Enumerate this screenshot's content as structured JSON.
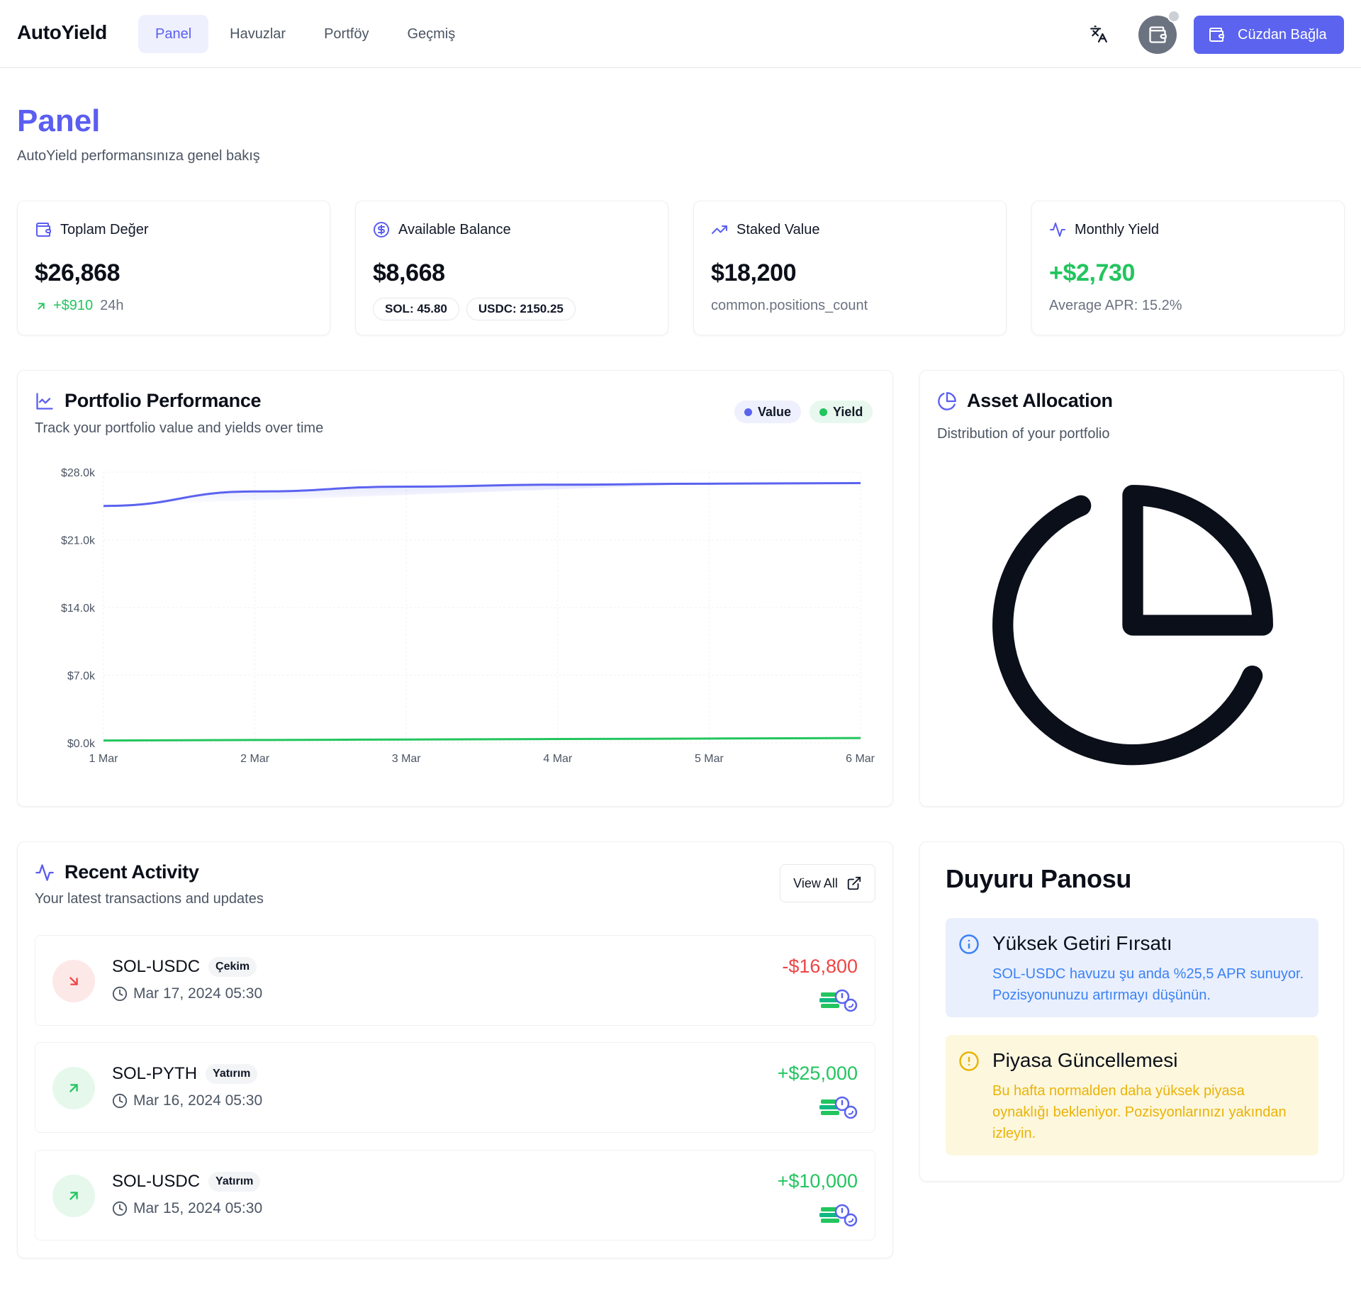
{
  "header": {
    "brand": "AutoYield",
    "nav": [
      {
        "label": "Panel",
        "active": true
      },
      {
        "label": "Havuzlar",
        "active": false
      },
      {
        "label": "Portföy",
        "active": false
      },
      {
        "label": "Geçmiş",
        "active": false
      }
    ],
    "connect_label": "Cüzdan Bağla"
  },
  "page": {
    "title": "Panel",
    "subtitle": "AutoYield performansınıza genel bakış"
  },
  "stats": {
    "total": {
      "label": "Toplam Değer",
      "value": "$26,868",
      "change": "+$910",
      "period": "24h"
    },
    "available": {
      "label": "Available Balance",
      "value": "$8,668",
      "sol": "SOL: 45.80",
      "usdc": "USDC: 2150.25"
    },
    "staked": {
      "label": "Staked Value",
      "value": "$18,200",
      "foot": "common.positions_count"
    },
    "monthly": {
      "label": "Monthly Yield",
      "value": "+$2,730",
      "foot": "Average APR: 15.2%"
    }
  },
  "performance": {
    "title": "Portfolio Performance",
    "subtitle": "Track your portfolio value and yields over time",
    "legend_value": "Value",
    "legend_yield": "Yield"
  },
  "chart_data": {
    "type": "area",
    "categories": [
      "1 Mar",
      "2 Mar",
      "3 Mar",
      "4 Mar",
      "5 Mar",
      "6 Mar"
    ],
    "series": [
      {
        "name": "Value",
        "values": [
          24500,
          26000,
          26500,
          26700,
          26800,
          26868
        ]
      },
      {
        "name": "Yield",
        "values": [
          250,
          300,
          350,
          400,
          450,
          500
        ]
      }
    ],
    "y_ticks": [
      "$0.0k",
      "$7.0k",
      "$14.0k",
      "$21.0k",
      "$28.0k"
    ],
    "ylim": [
      0,
      28000
    ],
    "grid": true,
    "colors": {
      "value": "#5b63ef",
      "yield": "#22c55e"
    }
  },
  "allocation": {
    "title": "Asset Allocation",
    "subtitle": "Distribution of your portfolio"
  },
  "activity": {
    "title": "Recent Activity",
    "subtitle": "Your latest transactions and updates",
    "view_all": "View All",
    "items": [
      {
        "pair": "SOL-USDC",
        "type": "Çekim",
        "date": "Mar 17, 2024 05:30",
        "amount": "-$16,800",
        "direction": "out"
      },
      {
        "pair": "SOL-PYTH",
        "type": "Yatırım",
        "date": "Mar 16, 2024 05:30",
        "amount": "+$25,000",
        "direction": "in"
      },
      {
        "pair": "SOL-USDC",
        "type": "Yatırım",
        "date": "Mar 15, 2024 05:30",
        "amount": "+$10,000",
        "direction": "in"
      }
    ]
  },
  "announcements": {
    "title": "Duyuru Panosu",
    "items": [
      {
        "title": "Yüksek Getiri Fırsatı",
        "text": "SOL-USDC havuzu şu anda %25,5 APR sunuyor. Pozisyonunuzu artırmayı düşünün.",
        "kind": "info"
      },
      {
        "title": "Piyasa Güncellemesi",
        "text": "Bu hafta normalden daha yüksek piyasa oynaklığı bekleniyor. Pozisyonlarınızı yakından izleyin.",
        "kind": "warning"
      }
    ]
  }
}
